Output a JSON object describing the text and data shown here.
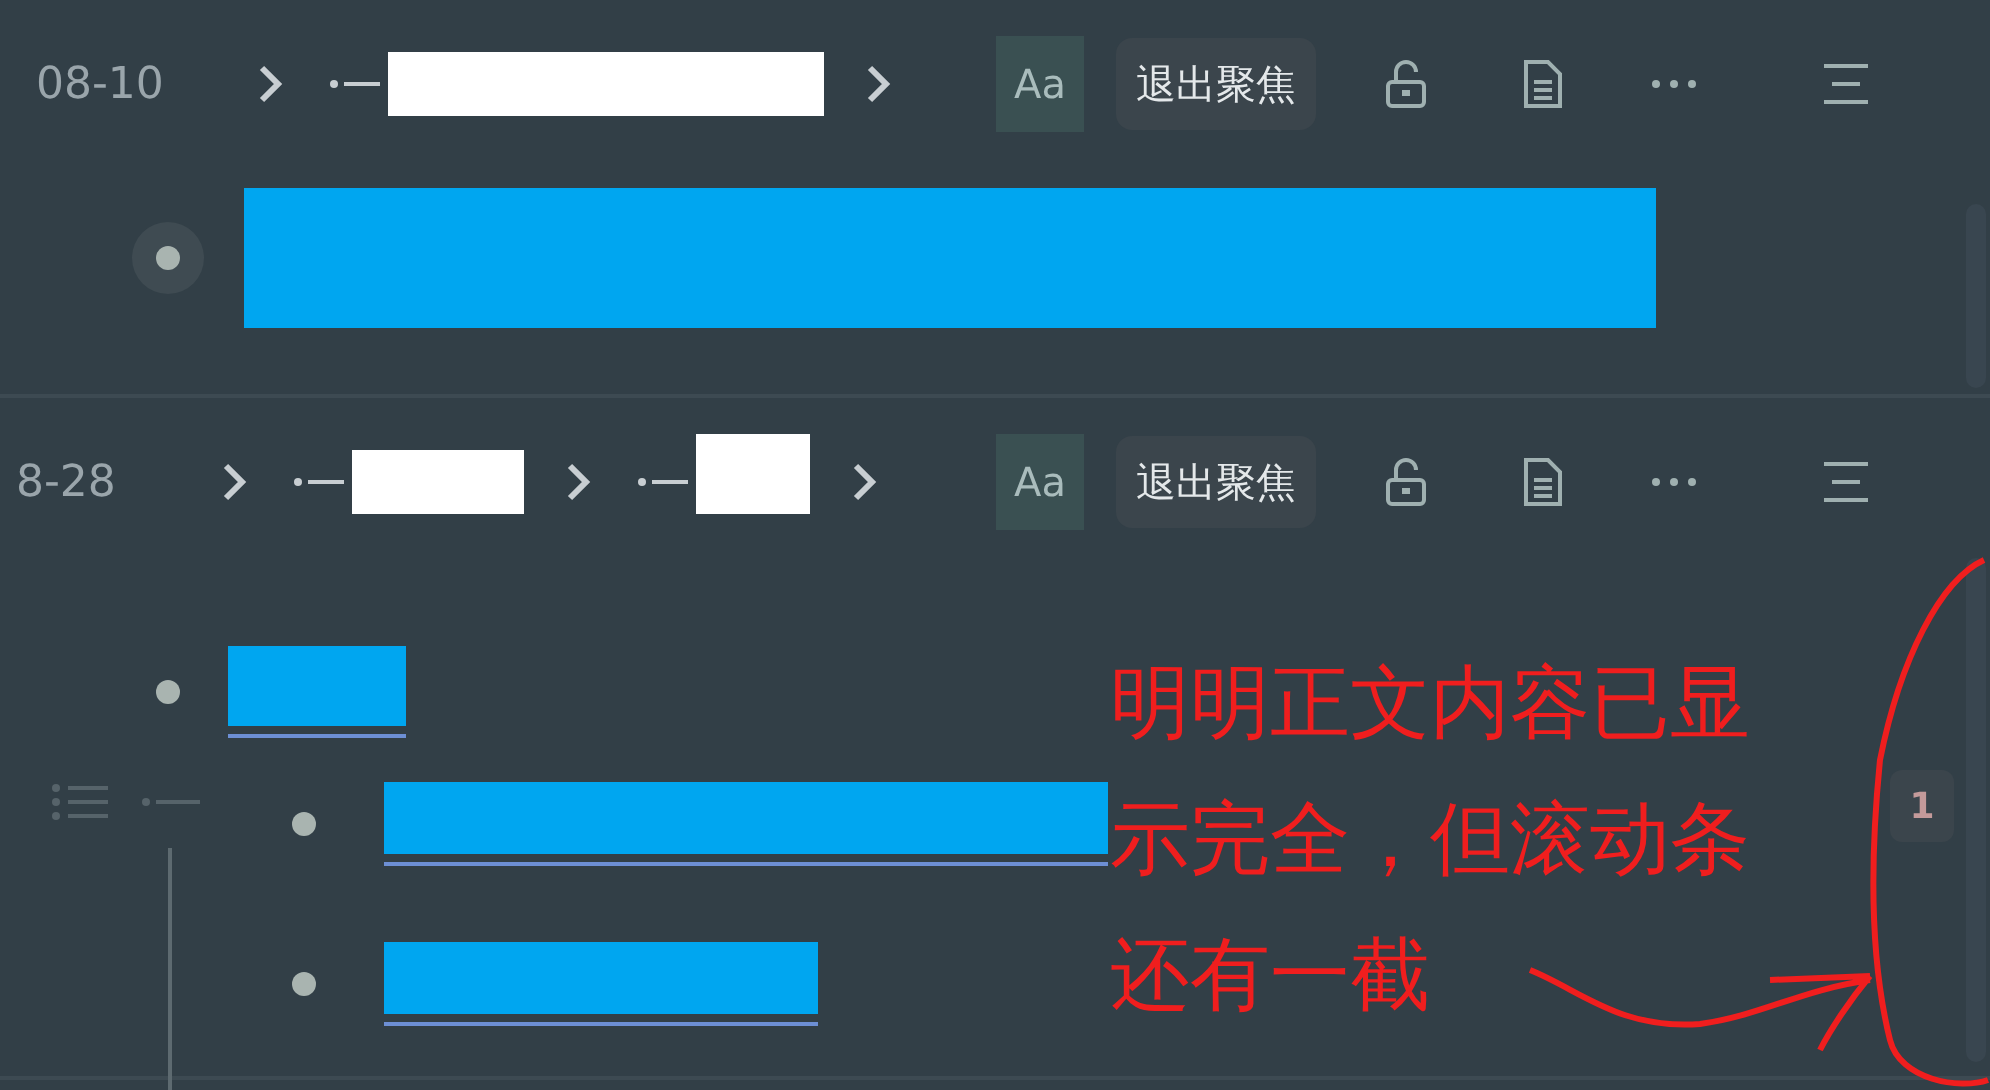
{
  "panels": [
    {
      "date": "08-10",
      "crumbs": [
        {
          "kind": "redacted"
        }
      ],
      "font_button": "Aa",
      "exit_focus": "退出聚焦",
      "items": [
        {
          "kind": "redacted",
          "focused": true
        }
      ]
    },
    {
      "date": "8-28",
      "crumbs": [
        {
          "kind": "redacted"
        },
        {
          "kind": "redacted"
        }
      ],
      "font_button": "Aa",
      "exit_focus": "退出聚焦",
      "items": [
        {
          "kind": "redacted",
          "focused": false,
          "children": [
            {
              "kind": "redacted",
              "focused": false
            },
            {
              "kind": "redacted",
              "focused": false
            }
          ]
        }
      ],
      "scroll_badge": "1"
    }
  ],
  "annotation": {
    "lines": [
      "明明正文内容已显",
      "示完全，但滚动条",
      "还有一截"
    ]
  }
}
